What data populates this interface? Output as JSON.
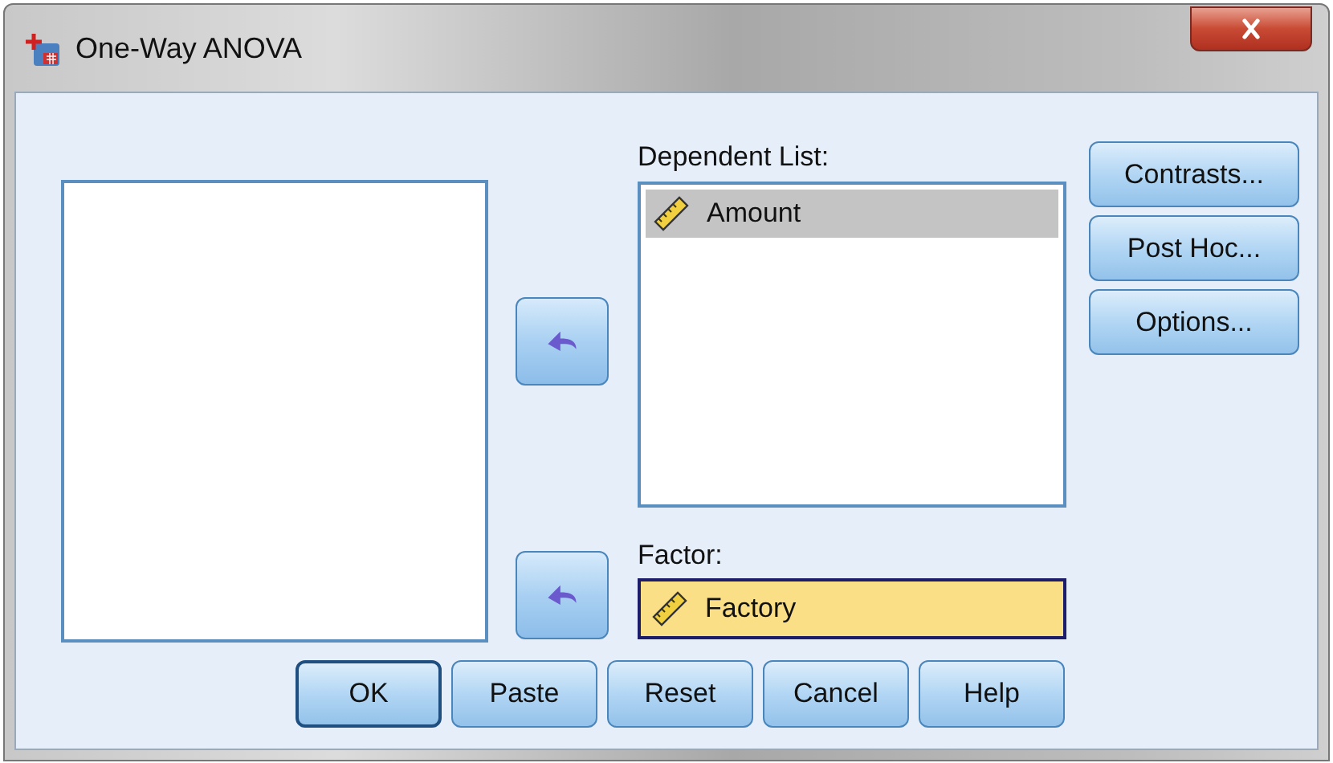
{
  "window": {
    "title": "One-Way ANOVA"
  },
  "dependent_list": {
    "label": "Dependent List:",
    "items": [
      {
        "name": "Amount",
        "selected": true
      }
    ]
  },
  "factor": {
    "label": "Factor:",
    "value": "Factory",
    "focused": true
  },
  "side_buttons": [
    {
      "label": "Contrasts..."
    },
    {
      "label": "Post Hoc..."
    },
    {
      "label": "Options..."
    }
  ],
  "buttons": [
    {
      "label": "OK",
      "default": true
    },
    {
      "label": "Paste",
      "default": false
    },
    {
      "label": "Reset",
      "default": false
    },
    {
      "label": "Cancel",
      "default": false
    },
    {
      "label": "Help",
      "default": false
    }
  ]
}
